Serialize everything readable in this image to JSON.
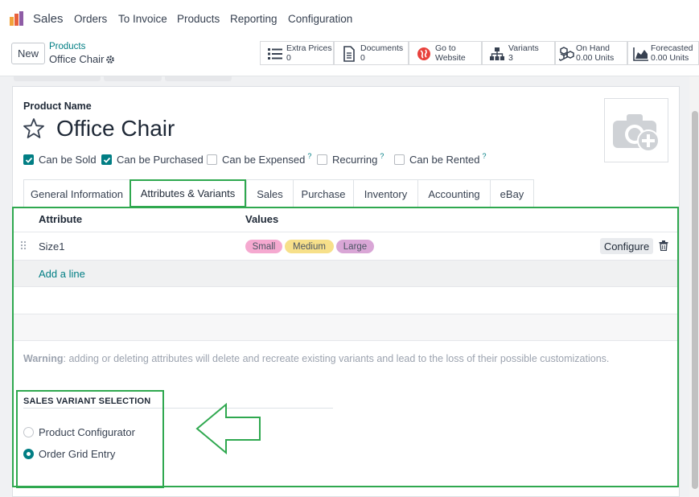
{
  "nav": {
    "app_name": "Sales",
    "menu": [
      "Orders",
      "To Invoice",
      "Products",
      "Reporting",
      "Configuration"
    ]
  },
  "control": {
    "new_label": "New",
    "breadcrumb": "Products",
    "record_title": "Office Chair",
    "smart_buttons": [
      {
        "icon": "list-icon",
        "line1": "Extra Prices",
        "line2": "0"
      },
      {
        "icon": "document-icon",
        "line1": "Documents",
        "line2": "0"
      },
      {
        "icon": "globe-icon",
        "line1": "Go to",
        "line2": "Website"
      },
      {
        "icon": "sitemap-icon",
        "line1": "Variants",
        "line2": "3"
      },
      {
        "icon": "cubes-icon",
        "line1": "On Hand",
        "line2": "0.00 Units"
      },
      {
        "icon": "area-chart-icon",
        "line1": "Forecasted",
        "line2": "0.00 Units"
      }
    ]
  },
  "form": {
    "product_name_label": "Product Name",
    "product_name": "Office Chair",
    "checkboxes": [
      {
        "label": "Can be Sold",
        "checked": true,
        "help": ""
      },
      {
        "label": "Can be Purchased",
        "checked": true,
        "help": ""
      },
      {
        "label": "Can be Expensed",
        "checked": false,
        "help": "?"
      },
      {
        "label": "Recurring",
        "checked": false,
        "help": "?"
      },
      {
        "label": "Can be Rented",
        "checked": false,
        "help": "?"
      }
    ],
    "tabs": [
      "General Information",
      "Attributes & Variants",
      "Sales",
      "Purchase",
      "Inventory",
      "Accounting",
      "eBay"
    ],
    "active_tab": "Attributes & Variants"
  },
  "attributes": {
    "col_attribute": "Attribute",
    "col_values": "Values",
    "rows": [
      {
        "name": "Size1",
        "values": [
          {
            "label": "Small",
            "color": "#f5a9d0"
          },
          {
            "label": "Medium",
            "color": "#f7e08a"
          },
          {
            "label": "Large",
            "color": "#d9a6d6"
          }
        ],
        "configure_label": "Configure"
      }
    ],
    "add_line": "Add a line",
    "warning_bold": "Warning",
    "warning_text": ": adding or deleting attributes will delete and recreate existing variants and lead to the loss of their possible customizations."
  },
  "sales_variant": {
    "title": "SALES VARIANT SELECTION",
    "options": [
      {
        "label": "Product Configurator",
        "selected": false
      },
      {
        "label": "Order Grid Entry",
        "selected": true
      }
    ]
  },
  "colors": {
    "accent": "#017e84",
    "highlight": "#2fa84f"
  }
}
